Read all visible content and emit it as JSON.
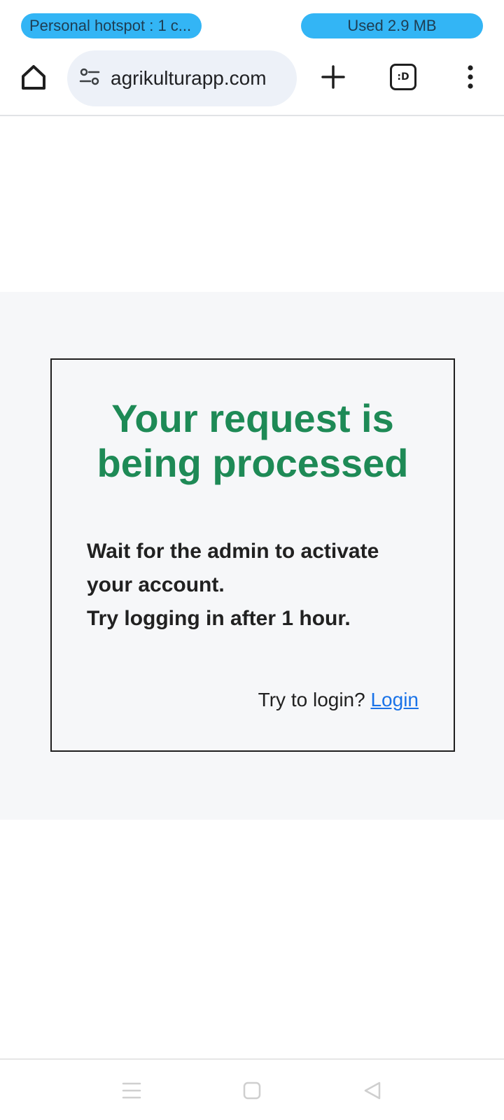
{
  "status_bar": {
    "hotspot_label": "Personal hotspot : 1 c...",
    "data_usage_label": "Used  2.9 MB",
    "pill_color": "#33b5f5"
  },
  "browser": {
    "url": "agrikulturapp.com",
    "tab_count": ":D",
    "icons": {
      "home": "home-icon",
      "site_settings": "site-settings-icon",
      "new_tab": "plus-icon",
      "tabs": "tab-switcher-icon",
      "menu": "more-vert-icon"
    }
  },
  "card": {
    "title_line1": "Your request is",
    "title_line2": "being processed",
    "message_line1": "Wait for the admin to activate",
    "message_line2": "your account.",
    "message_line3": "Try logging in after 1 hour.",
    "login_prompt": "Try to login?",
    "login_link": "Login",
    "title_color": "#1e8a56",
    "link_color": "#1a73e8"
  },
  "nav_bar": {
    "icons": [
      "recents-icon",
      "home-square-icon",
      "back-triangle-icon"
    ]
  }
}
